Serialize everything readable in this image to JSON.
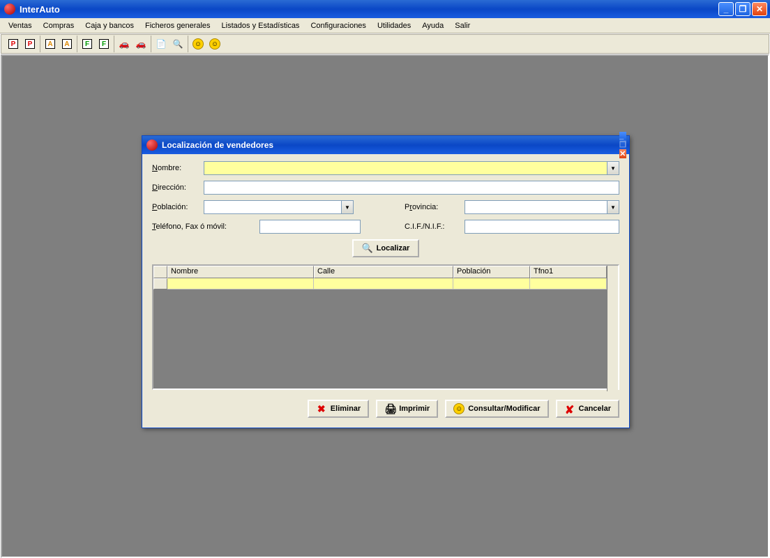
{
  "window": {
    "title": "InterAuto"
  },
  "menu": {
    "items": [
      "Ventas",
      "Compras",
      "Caja y bancos",
      "Ficheros generales",
      "Listados y Estadísticas",
      "Configuraciones",
      "Utilidades",
      "Ayuda",
      "Salir"
    ]
  },
  "dialog": {
    "title": "Localización de vendedores",
    "labels": {
      "nombre": "Nombre:",
      "direccion": "Dirección:",
      "poblacion": "Población:",
      "provincia": "Provincia:",
      "telefono": "Teléfono, Fax ó móvil:",
      "cif": "C.I.F./N.I.F.:"
    },
    "fields": {
      "nombre": "",
      "direccion": "",
      "poblacion": "",
      "provincia": "",
      "telefono": "",
      "cif": ""
    },
    "locateBtn": "Localizar",
    "grid": {
      "headers": [
        "Nombre",
        "Calle",
        "Población",
        "Tfno1"
      ],
      "rows": [
        {
          "nombre": "",
          "calle": "",
          "poblacion": "",
          "tfno1": ""
        }
      ]
    },
    "actions": {
      "eliminar": "Eliminar",
      "imprimir": "Imprimir",
      "consultar": "Consultar/Modificar",
      "cancelar": "Cancelar"
    }
  }
}
